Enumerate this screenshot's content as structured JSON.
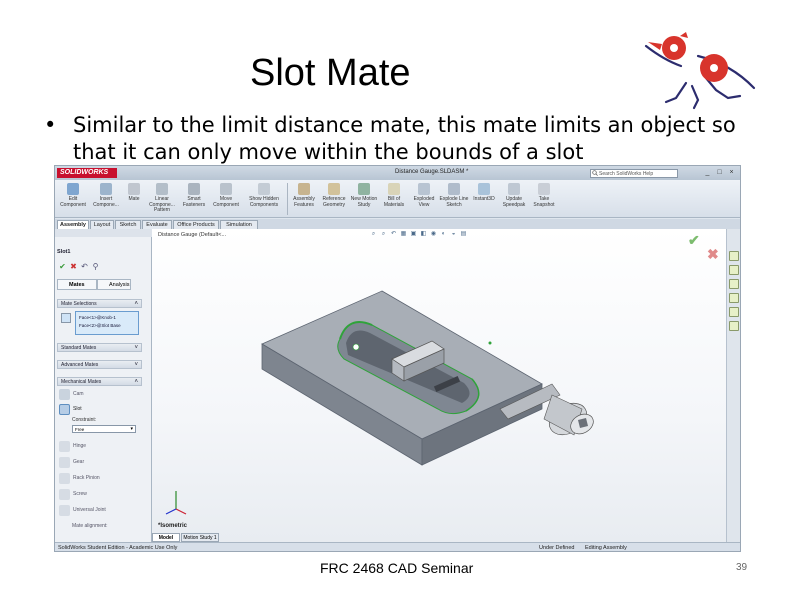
{
  "slide": {
    "title": "Slot Mate",
    "bullet_marker": "•",
    "bullet_text": "Similar to the limit distance mate, this mate limits an object so that it can only move within the bounds of a slot",
    "footer": "FRC 2468 CAD Seminar",
    "page_number": "39"
  },
  "app": {
    "logo_text": "SOLIDWORKS",
    "document_title": "Distance Gauge.SLDASM *",
    "search_placeholder": "Search SolidWorks Help",
    "window_controls": [
      "_",
      "□",
      "×"
    ]
  },
  "ribbon": {
    "buttons": [
      {
        "label": "Edit Component",
        "icon": "edit-component-icon"
      },
      {
        "label": "Insert Compone...",
        "icon": "insert-component-icon"
      },
      {
        "label": "Mate",
        "icon": "mate-icon"
      },
      {
        "label": "Linear Compone... Pattern",
        "icon": "linear-pattern-icon"
      },
      {
        "label": "Smart Fasteners",
        "icon": "smart-fasteners-icon"
      },
      {
        "label": "Move Component",
        "icon": "move-component-icon"
      },
      {
        "label": "Show Hidden Components",
        "icon": "show-hidden-icon"
      },
      {
        "label": "Assembly Features",
        "icon": "assembly-features-icon"
      },
      {
        "label": "Reference Geometry",
        "icon": "reference-geometry-icon"
      },
      {
        "label": "New Motion Study",
        "icon": "motion-study-icon"
      },
      {
        "label": "Bill of Materials",
        "icon": "bom-icon"
      },
      {
        "label": "Exploded View",
        "icon": "exploded-view-icon"
      },
      {
        "label": "Explode Line Sketch",
        "icon": "explode-line-icon"
      },
      {
        "label": "Instant3D",
        "icon": "instant3d-icon"
      },
      {
        "label": "Update Speedpak",
        "icon": "speedpak-icon"
      },
      {
        "label": "Take Snapshot",
        "icon": "snapshot-icon"
      }
    ]
  },
  "tabs": [
    "Assembly",
    "Layout",
    "Sketch",
    "Evaluate",
    "Office Products",
    "Simulation"
  ],
  "property_manager": {
    "title": "Slot1",
    "subtabs": [
      "Mates",
      "Analysis"
    ],
    "mate_selections_header": "Mate Selections",
    "selections": [
      "Face<1>@Knob-1",
      "Face<2>@Slot Base"
    ],
    "standard_mates_header": "Standard Mates",
    "advanced_mates_header": "Advanced Mates",
    "mechanical_mates_header": "Mechanical Mates",
    "mechanical_mates": [
      "Cam",
      "Slot",
      "Hinge",
      "Gear",
      "Rack Pinion",
      "Screw",
      "Universal Joint"
    ],
    "constraint_label": "Constraint:",
    "constraint_value": "Free",
    "mate_alignment_label": "Mate alignment:"
  },
  "viewport": {
    "document_label": "Distance Gauge (Default<...",
    "view_label": "*Isometric"
  },
  "bottom_tabs": [
    "Model",
    "Motion Study 1"
  ],
  "status": {
    "left": "SolidWorks Student Edition - Academic Use Only",
    "right1": "Under Defined",
    "right2": "Editing Assembly"
  },
  "colors": {
    "part_body": "#9ea4ad",
    "slot_green": "#2fa33a",
    "knob_block": "#c9ccd1"
  }
}
